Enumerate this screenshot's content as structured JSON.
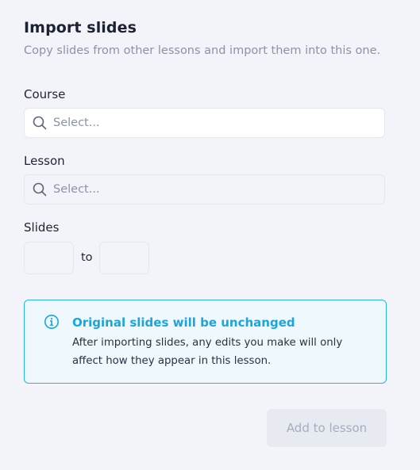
{
  "header": {
    "title": "Import slides",
    "subtitle": "Copy slides from other lessons and import them into this one."
  },
  "course": {
    "label": "Course",
    "placeholder": "Select..."
  },
  "lesson": {
    "label": "Lesson",
    "placeholder": "Select..."
  },
  "slides": {
    "label": "Slides",
    "from_value": "",
    "to_value": "",
    "separator": "to"
  },
  "notice": {
    "icon": "info-circle-icon",
    "title": "Original slides will be unchanged",
    "body": "After importing slides, any edits you make will only affect how they appear in this lesson."
  },
  "actions": {
    "add_label": "Add to lesson"
  },
  "colors": {
    "background": "#f2f4f9",
    "accent": "#1aa6dc",
    "notice_border": "#27b4e6",
    "notice_bg": "#eef8fd",
    "muted_text": "#8a92a6",
    "disabled_button_bg": "#e7eaf1",
    "disabled_button_text": "#a7adbd"
  }
}
